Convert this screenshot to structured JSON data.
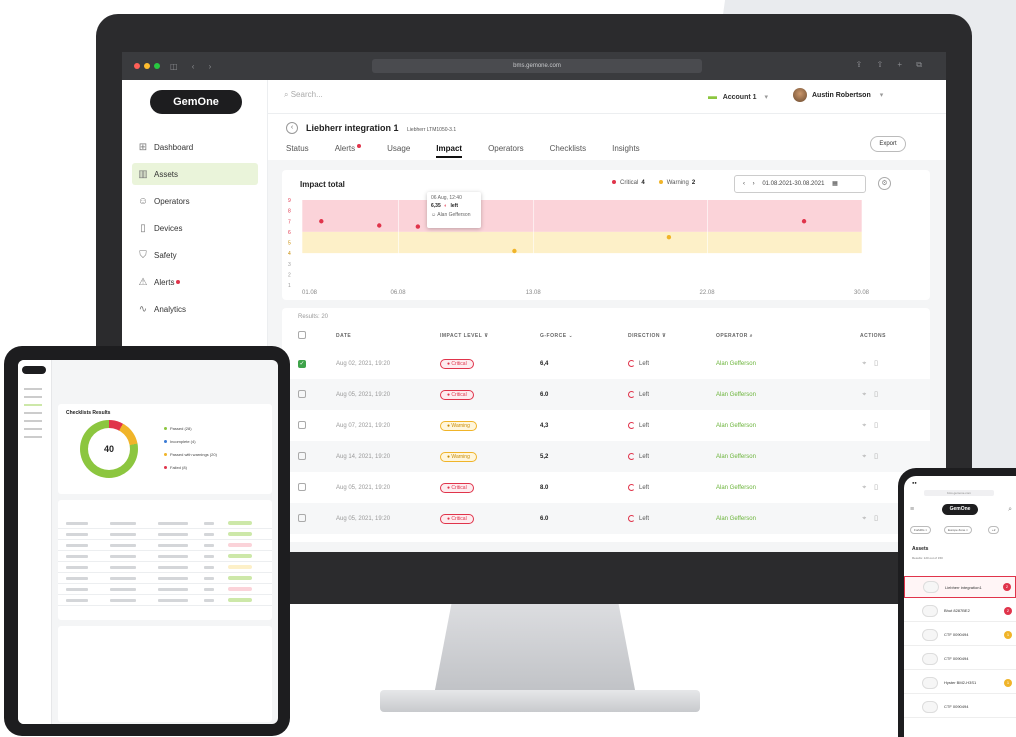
{
  "browser": {
    "url": "bms.gemone.com"
  },
  "app": {
    "logo": "GemOne",
    "search_placeholder": "Search...",
    "account_label": "Account 1",
    "account_chevron": "▾",
    "user_name": "Austin Robertson",
    "user_chevron": "▾"
  },
  "sidebar": {
    "items": [
      {
        "label": "Dashboard",
        "icon": "dashboard-icon",
        "glyph": "⊞"
      },
      {
        "label": "Assets",
        "icon": "assets-icon",
        "glyph": "▥"
      },
      {
        "label": "Operators",
        "icon": "operators-icon",
        "glyph": "☺"
      },
      {
        "label": "Devices",
        "icon": "devices-icon",
        "glyph": "▯"
      },
      {
        "label": "Safety",
        "icon": "safety-icon",
        "glyph": "⛉"
      },
      {
        "label": "Alerts",
        "icon": "alerts-icon",
        "glyph": "⚠"
      },
      {
        "label": "Analytics",
        "icon": "analytics-icon",
        "glyph": "∿"
      }
    ],
    "active_index": 1,
    "bottom_icons": [
      "settings-icon",
      "help-icon"
    ]
  },
  "asset": {
    "title": "Liebherr integration 1",
    "subtitle": "Liebherr LTM1050-3.1",
    "tabs": [
      "Status",
      "Alerts",
      "Usage",
      "Impact",
      "Operators",
      "Checklists",
      "Insights"
    ],
    "active_tab": "Impact",
    "export_label": "Export"
  },
  "impact_chart": {
    "title": "Impact total",
    "legend": [
      {
        "label": "Critical",
        "count": "4",
        "color": "#e0344b"
      },
      {
        "label": "Warning",
        "count": "2",
        "color": "#f0b429"
      }
    ],
    "date_range": "01.08.2021-30.08.2021",
    "tooltip": {
      "date": "06 Aug, 12:40",
      "value": "6,35",
      "direction": "left",
      "operator": "Alan Gefferson"
    }
  },
  "chart_data": {
    "type": "scatter",
    "x_ticks": [
      "01.08",
      "06.08",
      "13.08",
      "22.08",
      "30.08"
    ],
    "y_ticks": [
      "1",
      "2",
      "3",
      "4",
      "5",
      "6",
      "7",
      "8",
      "9"
    ],
    "ylim": [
      1,
      9
    ],
    "xlim": [
      1,
      30
    ],
    "bands": [
      {
        "name": "critical",
        "from": 6,
        "to": 9,
        "color": "#fbd3d9"
      },
      {
        "name": "warning",
        "from": 4,
        "to": 6,
        "color": "#fdf0c8"
      }
    ],
    "series": [
      {
        "name": "Critical",
        "color": "#e0344b",
        "points": [
          [
            2,
            7.0
          ],
          [
            5,
            6.6
          ],
          [
            7,
            6.5
          ],
          [
            27,
            7.0
          ]
        ]
      },
      {
        "name": "Warning",
        "color": "#f0b429",
        "points": [
          [
            12,
            4.2
          ],
          [
            20,
            5.5
          ]
        ]
      }
    ]
  },
  "results": {
    "label": "Results: 20",
    "columns": [
      "DATE",
      "IMPACT LEVEL",
      "G-FORCE",
      "DIRECTION",
      "OPERATOR",
      "ACTIONS"
    ],
    "rows": [
      {
        "date": "Aug 02, 2021, 19:20",
        "level": "Critical",
        "gforce": "6,4",
        "direction": "Left",
        "operator": "Alan Gefferson",
        "checked": true
      },
      {
        "date": "Aug 05, 2021, 19:20",
        "level": "Critical",
        "gforce": "6.0",
        "direction": "Left",
        "operator": "Alan Gefferson",
        "checked": false
      },
      {
        "date": "Aug 07, 2021, 19:20",
        "level": "Warning",
        "gforce": "4,3",
        "direction": "Left",
        "operator": "Alan Gefferson",
        "checked": false
      },
      {
        "date": "Aug 14, 2021, 19:20",
        "level": "Warning",
        "gforce": "5,2",
        "direction": "Left",
        "operator": "Alan Gefferson",
        "checked": false
      },
      {
        "date": "Aug 05, 2021, 19:20",
        "level": "Critical",
        "gforce": "8.0",
        "direction": "Left",
        "operator": "Alan Gefferson",
        "checked": false
      },
      {
        "date": "Aug 05, 2021, 19:20",
        "level": "Critical",
        "gforce": "6.0",
        "direction": "Left",
        "operator": "Alan Gefferson",
        "checked": false
      }
    ]
  },
  "tablet": {
    "card_title": "Checklists Results",
    "donut_value": "40",
    "legend": [
      {
        "label": "Passed (28)",
        "color": "#8cc63f"
      },
      {
        "label": "Incomplete (4)",
        "color": "#3a7bd5"
      },
      {
        "label": "Passed with warnings (20)",
        "color": "#f0b429"
      },
      {
        "label": "Failed (8)",
        "color": "#e0344b"
      }
    ]
  },
  "phone": {
    "logo": "GemOne",
    "filters": [
      "Forklifts ×",
      "Europe Zone ×",
      "+2"
    ],
    "section_title": "Assets",
    "results_text": "Results: 120 out of 150",
    "rows": [
      {
        "name": "Liebherr integration1",
        "badge": "2",
        "color": "#e0344b"
      },
      {
        "name": "Bhut 8287BE2",
        "badge": "2",
        "color": "#e0344b"
      },
      {
        "name": "CTF 0090494",
        "badge": "1",
        "color": "#f0b429"
      },
      {
        "name": "CTF 0090494",
        "badge": "",
        "color": ""
      },
      {
        "name": "Hyster BM2-H3S1",
        "badge": "1",
        "color": "#f0b429"
      },
      {
        "name": "CTF 0090494",
        "badge": "",
        "color": ""
      }
    ]
  }
}
